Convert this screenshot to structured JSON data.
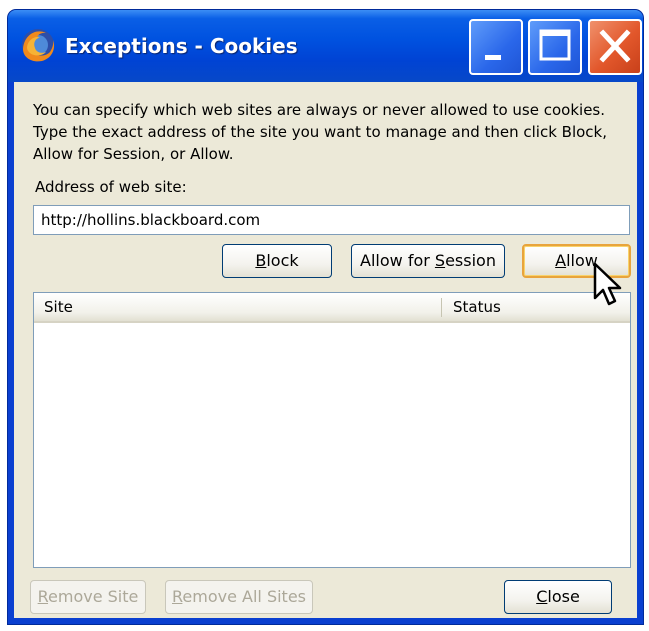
{
  "window": {
    "title": "Exceptions - Cookies",
    "app_icon": "firefox-icon",
    "controls": [
      "minimize-icon",
      "maximize-icon",
      "close-icon"
    ]
  },
  "description": "You can specify which web sites are always or never allowed to use cookies. Type the exact address of the site you want to manage and then click Block, Allow for Session, or Allow.",
  "address": {
    "label": "Address of web site:",
    "value": "http://hollins.blackboard.com"
  },
  "actions": {
    "block": {
      "pre": "",
      "key": "B",
      "post": "lock"
    },
    "allow_session": {
      "pre": "Allow for ",
      "key": "S",
      "post": "ession"
    },
    "allow": {
      "pre": "",
      "key": "A",
      "post": "llow"
    }
  },
  "table": {
    "columns": [
      "Site",
      "Status"
    ],
    "rows": []
  },
  "footer": {
    "remove_site": {
      "pre": "",
      "key": "R",
      "post": "emove Site"
    },
    "remove_all": {
      "pre": "",
      "key": "R",
      "post": "emove All Sites"
    },
    "close": {
      "pre": "",
      "key": "C",
      "post": "lose"
    }
  },
  "colors": {
    "titlebar": "#0052e0",
    "dialog_bg": "#ece9d8",
    "focus_border": "#e8a43c",
    "close_button": "#e2572b"
  }
}
